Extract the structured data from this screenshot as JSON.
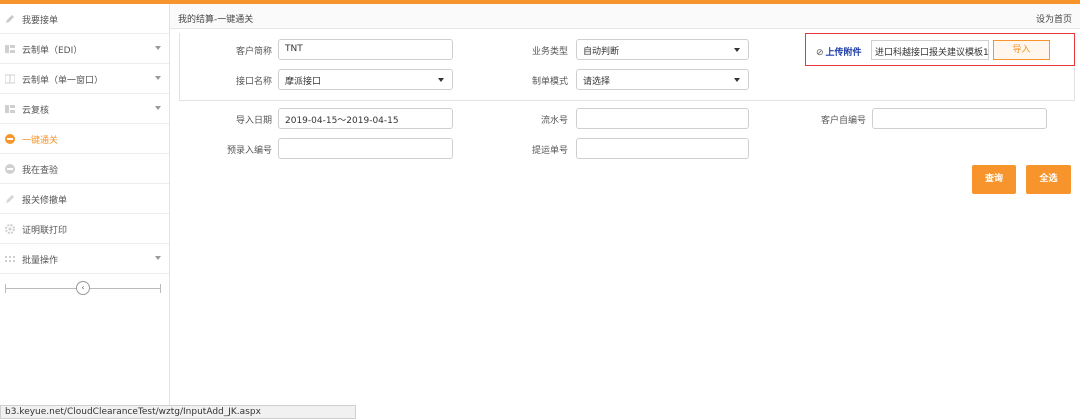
{
  "accent_color": "#f7942b",
  "sidebar": {
    "items": [
      {
        "label": "我要接单",
        "icon": "pencil-icon",
        "chevron": false,
        "active": false
      },
      {
        "label": "云制单（EDI）",
        "icon": "grid-icon",
        "chevron": true,
        "active": false
      },
      {
        "label": "云制单（单一窗口）",
        "icon": "grid-icon",
        "chevron": true,
        "active": false
      },
      {
        "label": "云复核",
        "icon": "grid-icon",
        "chevron": true,
        "active": false
      },
      {
        "label": "一键通关",
        "icon": "minus-circle-icon",
        "chevron": false,
        "active": true
      },
      {
        "label": "我在查验",
        "icon": "minus-circle-icon",
        "chevron": false,
        "active": false
      },
      {
        "label": "报关修撤单",
        "icon": "pencil-icon",
        "chevron": false,
        "active": false
      },
      {
        "label": "证明联打印",
        "icon": "gear-icon",
        "chevron": false,
        "active": false
      },
      {
        "label": "批量操作",
        "icon": "dots-grid-icon",
        "chevron": true,
        "active": false
      }
    ],
    "collapse_symbol": "‹"
  },
  "header": {
    "breadcrumb": "我的结算-一键通关",
    "set_home": "设为首页"
  },
  "form": {
    "customer_short_label": "客户简称",
    "customer_short_value": "TNT",
    "interface_name_label": "接口名称",
    "interface_name_value": "摩派接口",
    "business_type_label": "业务类型",
    "business_type_value": "自动判断",
    "form_mode_label": "制单模式",
    "form_mode_value": "请选择",
    "upload_label": "上传附件",
    "upload_file": "进口科越接口报关建议模板1(",
    "import_button": "导入",
    "import_date_label": "导入日期",
    "import_date_value": "2019-04-15～2019-04-15",
    "serial_label": "流水号",
    "customer_no_label": "客户自编号",
    "pre_entry_label": "预录入编号",
    "bill_no_label": "提运单号"
  },
  "buttons": {
    "query": "查询",
    "select_all": "全选"
  },
  "status_url": "b3.keyue.net/CloudClearanceTest/wztg/InputAdd_JK.aspx"
}
